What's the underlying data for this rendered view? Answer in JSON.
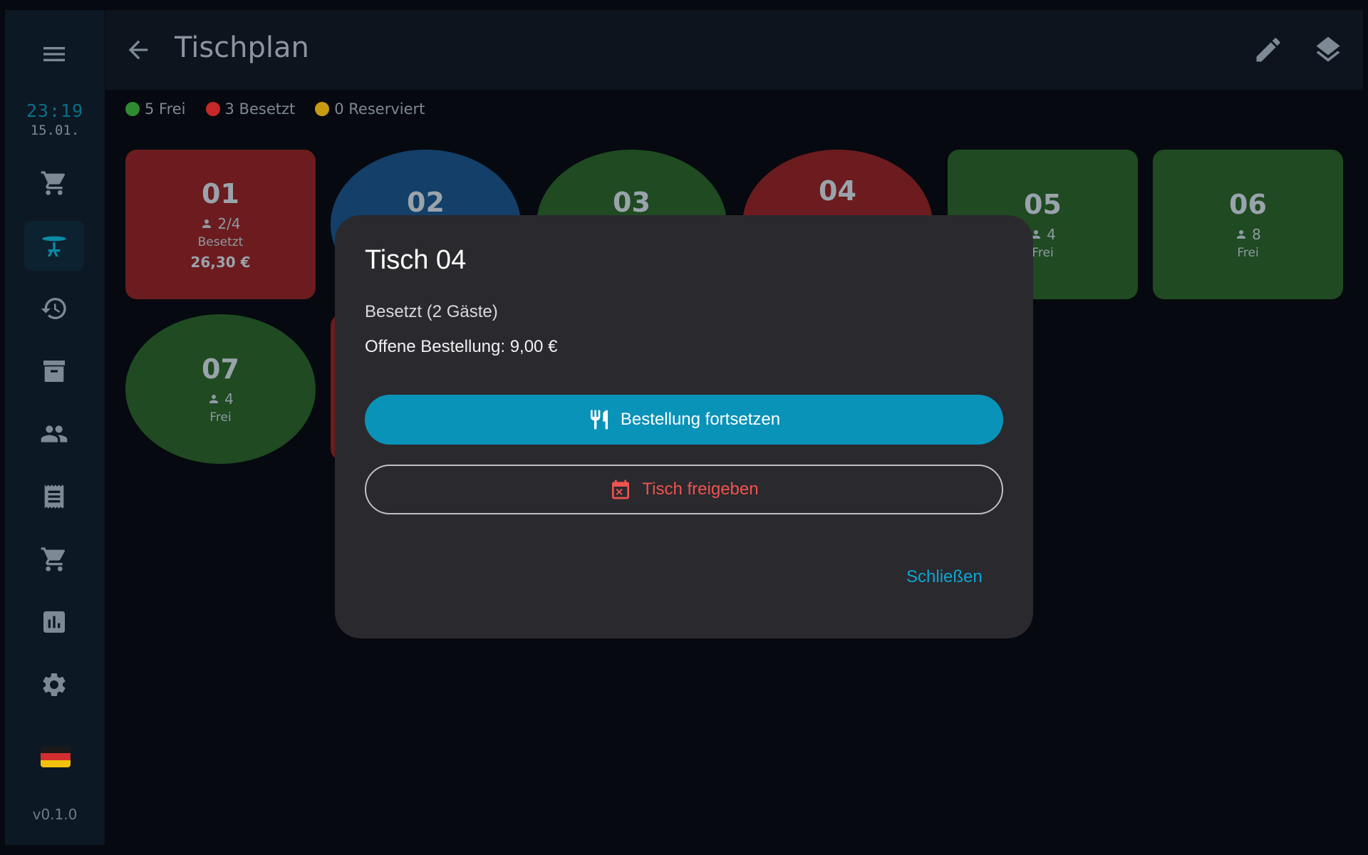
{
  "sidebar": {
    "clock_time": "23:19",
    "clock_date": "15.01.",
    "version": "v0.1.0",
    "icons": [
      "menu-icon",
      "cart-icon",
      "table-icon",
      "history-icon",
      "archive-icon",
      "people-icon",
      "receipt-icon",
      "cart-icon",
      "chart-icon",
      "gear-icon",
      "flag-germany-icon"
    ]
  },
  "header": {
    "title": "Tischplan"
  },
  "legend": {
    "free": "5 Frei",
    "occupied": "3 Besetzt",
    "reserved": "0 Reserviert"
  },
  "colors": {
    "free": "#2e8b32",
    "occupied": "#c62828",
    "reserved": "#c89a12",
    "accent": "#0a93b8"
  },
  "tables": [
    {
      "number": "01",
      "guests": "2/4",
      "status": "Besetzt",
      "amount": "26,30 €",
      "state": "occupied"
    },
    {
      "number": "02",
      "guests": "",
      "status": "",
      "amount": "",
      "state": "selected"
    },
    {
      "number": "03",
      "guests": "",
      "status": "",
      "amount": "",
      "state": "free"
    },
    {
      "number": "04",
      "guests": "",
      "status": "",
      "amount": "",
      "state": "occupied"
    },
    {
      "number": "05",
      "guests": "4",
      "status": "Frei",
      "amount": "",
      "state": "free"
    },
    {
      "number": "06",
      "guests": "8",
      "status": "Frei",
      "amount": "",
      "state": "free"
    },
    {
      "number": "07",
      "guests": "4",
      "status": "Frei",
      "amount": "",
      "state": "free"
    }
  ],
  "dialog": {
    "title": "Tisch 04",
    "status": "Besetzt (2 Gäste)",
    "order": "Offene Bestellung: 9,00 €",
    "continue_label": "Bestellung fortsetzen",
    "release_label": "Tisch freigeben",
    "close_label": "Schließen"
  }
}
